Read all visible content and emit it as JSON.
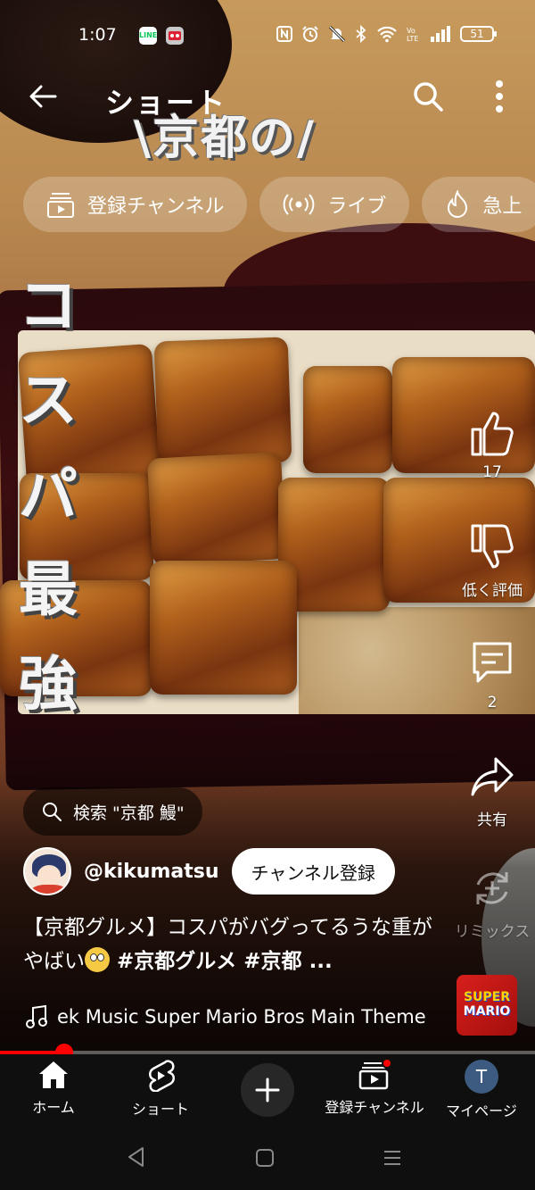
{
  "status_bar": {
    "time": "1:07",
    "battery": "51",
    "notif_icons": [
      "LINE",
      "app-notification"
    ]
  },
  "appbar": {
    "title": "ショート"
  },
  "overlay": {
    "title_text": "\\京都の/",
    "vertical_text": "コスパ最強"
  },
  "chips": [
    {
      "label": "登録チャンネル",
      "icon": "subscriptions-icon"
    },
    {
      "label": "ライブ",
      "icon": "live-icon"
    },
    {
      "label": "急上",
      "icon": "trending-icon"
    }
  ],
  "rail": {
    "like_count": "17",
    "dislike_label": "低く評価",
    "comment_count": "2",
    "share_label": "共有",
    "remix_label": "リミックス"
  },
  "search_suggestion": "検索 \"京都 鰻\"",
  "channel": {
    "handle": "@kikumatsu",
    "subscribe_label": "チャンネル登録"
  },
  "video": {
    "title_part1": "【京都グルメ】コスパがバグってるうな重がやばい",
    "title_tags": " #京都グルメ #京都 ..."
  },
  "music": {
    "track": "ek Music    Super Mario Bros Main Theme",
    "art_line1": "SUPER",
    "art_line2": "MARIO"
  },
  "progress": {
    "fraction": 0.12
  },
  "nav": {
    "home": "ホーム",
    "shorts": "ショート",
    "subscriptions": "登録チャンネル",
    "you": "マイページ",
    "profile_initial": "T"
  },
  "colors": {
    "accent_red": "#ff0000",
    "nav_bg": "#0f0f0f"
  }
}
